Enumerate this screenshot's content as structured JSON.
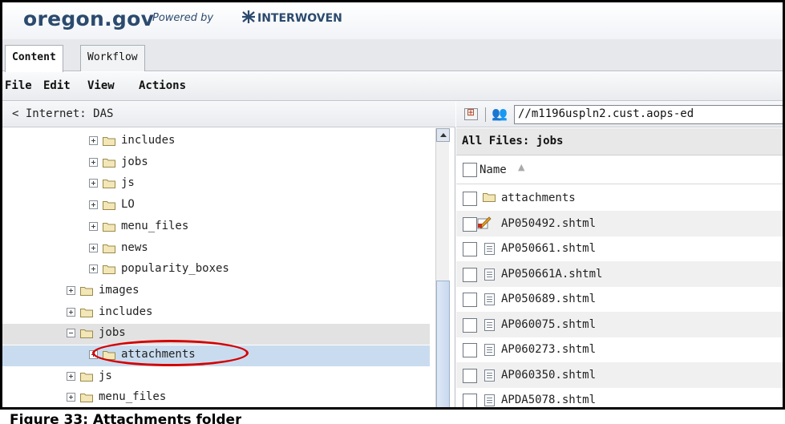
{
  "brand": {
    "logo": "oregon.gov",
    "powered_by": "Powered by",
    "vendor": "INTERWOVEN"
  },
  "tabs": [
    {
      "label": "Content",
      "active": true
    },
    {
      "label": "Workflow",
      "active": false
    }
  ],
  "menu": [
    "File",
    "Edit",
    "View",
    "Actions"
  ],
  "left_pane": {
    "breadcrumb": "< Internet: DAS",
    "tree": [
      {
        "label": "includes",
        "level": 2,
        "expander": "plus"
      },
      {
        "label": "jobs",
        "level": 2,
        "expander": "plus"
      },
      {
        "label": "js",
        "level": 2,
        "expander": "plus"
      },
      {
        "label": "LO",
        "level": 2,
        "expander": "plus"
      },
      {
        "label": "menu_files",
        "level": 2,
        "expander": "plus"
      },
      {
        "label": "news",
        "level": 2,
        "expander": "plus"
      },
      {
        "label": "popularity_boxes",
        "level": 2,
        "expander": "plus"
      },
      {
        "label": "images",
        "level": 1,
        "expander": "plus"
      },
      {
        "label": "includes",
        "level": 1,
        "expander": "plus"
      },
      {
        "label": "jobs",
        "level": 1,
        "expander": "minus",
        "state": "expanded"
      },
      {
        "label": "attachments",
        "level": 2,
        "expander": "plus",
        "state": "selected"
      },
      {
        "label": "js",
        "level": 1,
        "expander": "plus"
      },
      {
        "label": "menu_files",
        "level": 1,
        "expander": "plus"
      }
    ]
  },
  "right_pane": {
    "path": "//m1196uspln2.cust.aops-ed",
    "title": "All Files: jobs",
    "column_header": "Name",
    "sort_indicator": "▲",
    "files": [
      {
        "name": "attachments",
        "icon": "folder-icon"
      },
      {
        "name": "AP050492.shtml",
        "icon": "edited-file-icon"
      },
      {
        "name": "AP050661.shtml",
        "icon": "document-icon"
      },
      {
        "name": "AP050661A.shtml",
        "icon": "document-icon"
      },
      {
        "name": "AP050689.shtml",
        "icon": "document-icon"
      },
      {
        "name": "AP060075.shtml",
        "icon": "document-icon"
      },
      {
        "name": "AP060273.shtml",
        "icon": "document-icon"
      },
      {
        "name": "AP060350.shtml",
        "icon": "document-icon"
      },
      {
        "name": "APDA5078.shtml",
        "icon": "document-icon"
      }
    ]
  },
  "caption": "Figure 33: Attachments folder",
  "colors": {
    "brand_text": "#2b4a6e",
    "selection": "#c9dcef",
    "highlight_circle": "#d40000",
    "folder": "#f3e7b8"
  }
}
